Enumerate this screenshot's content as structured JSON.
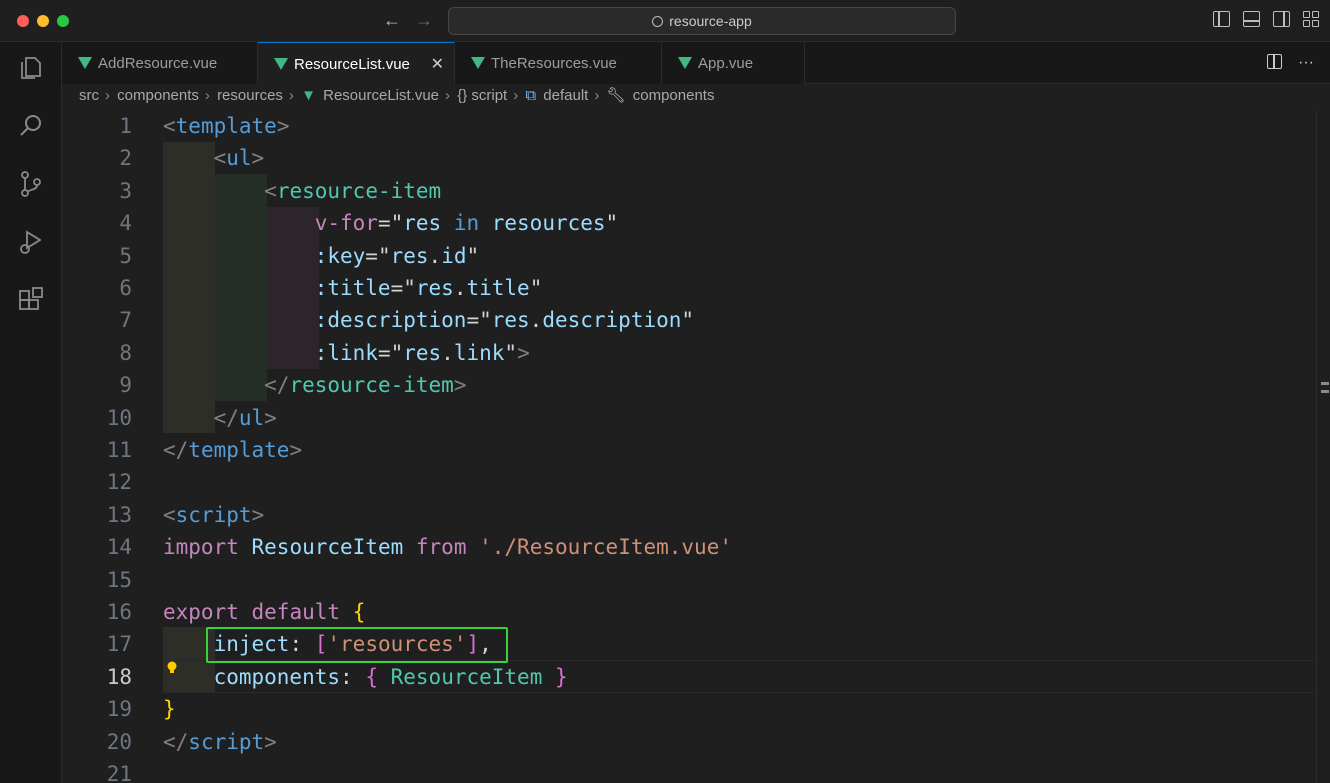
{
  "window": {
    "title": "resource-app"
  },
  "tabs": [
    {
      "label": "AddResource.vue",
      "active": false
    },
    {
      "label": "ResourceList.vue",
      "active": true
    },
    {
      "label": "TheResources.vue",
      "active": false
    },
    {
      "label": "App.vue",
      "active": false
    }
  ],
  "tab_actions": {
    "close_label": "✕",
    "more_label": "···"
  },
  "breadcrumbs": [
    "src",
    "components",
    "resources",
    "ResourceList.vue",
    "{} script",
    "default",
    "components"
  ],
  "editor": {
    "current_line": "18",
    "line_numbers": [
      "1",
      "2",
      "3",
      "4",
      "5",
      "6",
      "7",
      "8",
      "9",
      "10",
      "11",
      "12",
      "13",
      "14",
      "15",
      "16",
      "17",
      "18",
      "19",
      "20",
      "21"
    ],
    "tokens": {
      "l1": [
        "<",
        "template",
        ">"
      ],
      "l2": [
        "<",
        "ul",
        ">"
      ],
      "l3": [
        "<",
        "resource-item"
      ],
      "l4": [
        "v-for",
        "=\"",
        "res",
        " in ",
        "resources",
        "\""
      ],
      "l5": [
        ":key",
        "=\"",
        "res",
        ".",
        "id",
        "\""
      ],
      "l6": [
        ":title",
        "=\"",
        "res",
        ".",
        "title",
        "\""
      ],
      "l7": [
        ":description",
        "=\"",
        "res",
        ".",
        "description",
        "\""
      ],
      "l8": [
        ":link",
        "=\"",
        "res",
        ".",
        "link",
        "\"",
        ">"
      ],
      "l9": [
        "</",
        "resource-item",
        ">"
      ],
      "l10": [
        "</",
        "ul",
        ">"
      ],
      "l11": [
        "</",
        "template",
        ">"
      ],
      "l13": [
        "<",
        "script",
        ">"
      ],
      "l14": [
        "import",
        " ",
        "ResourceItem",
        " ",
        "from",
        " ",
        "'./ResourceItem.vue'"
      ],
      "l16": [
        "export",
        " ",
        "default",
        " ",
        "{"
      ],
      "l17": [
        "inject",
        ": ",
        "[",
        "'resources'",
        "]",
        ","
      ],
      "l18": [
        "components",
        ": ",
        "{",
        " ",
        "ResourceItem",
        " ",
        "}"
      ],
      "l19": [
        "}"
      ],
      "l20": [
        "</",
        "script",
        ">"
      ]
    }
  },
  "colors": {
    "accent": "#0078d4",
    "highlight_box": "#3bd13b",
    "vue_logo": "#41b883"
  }
}
